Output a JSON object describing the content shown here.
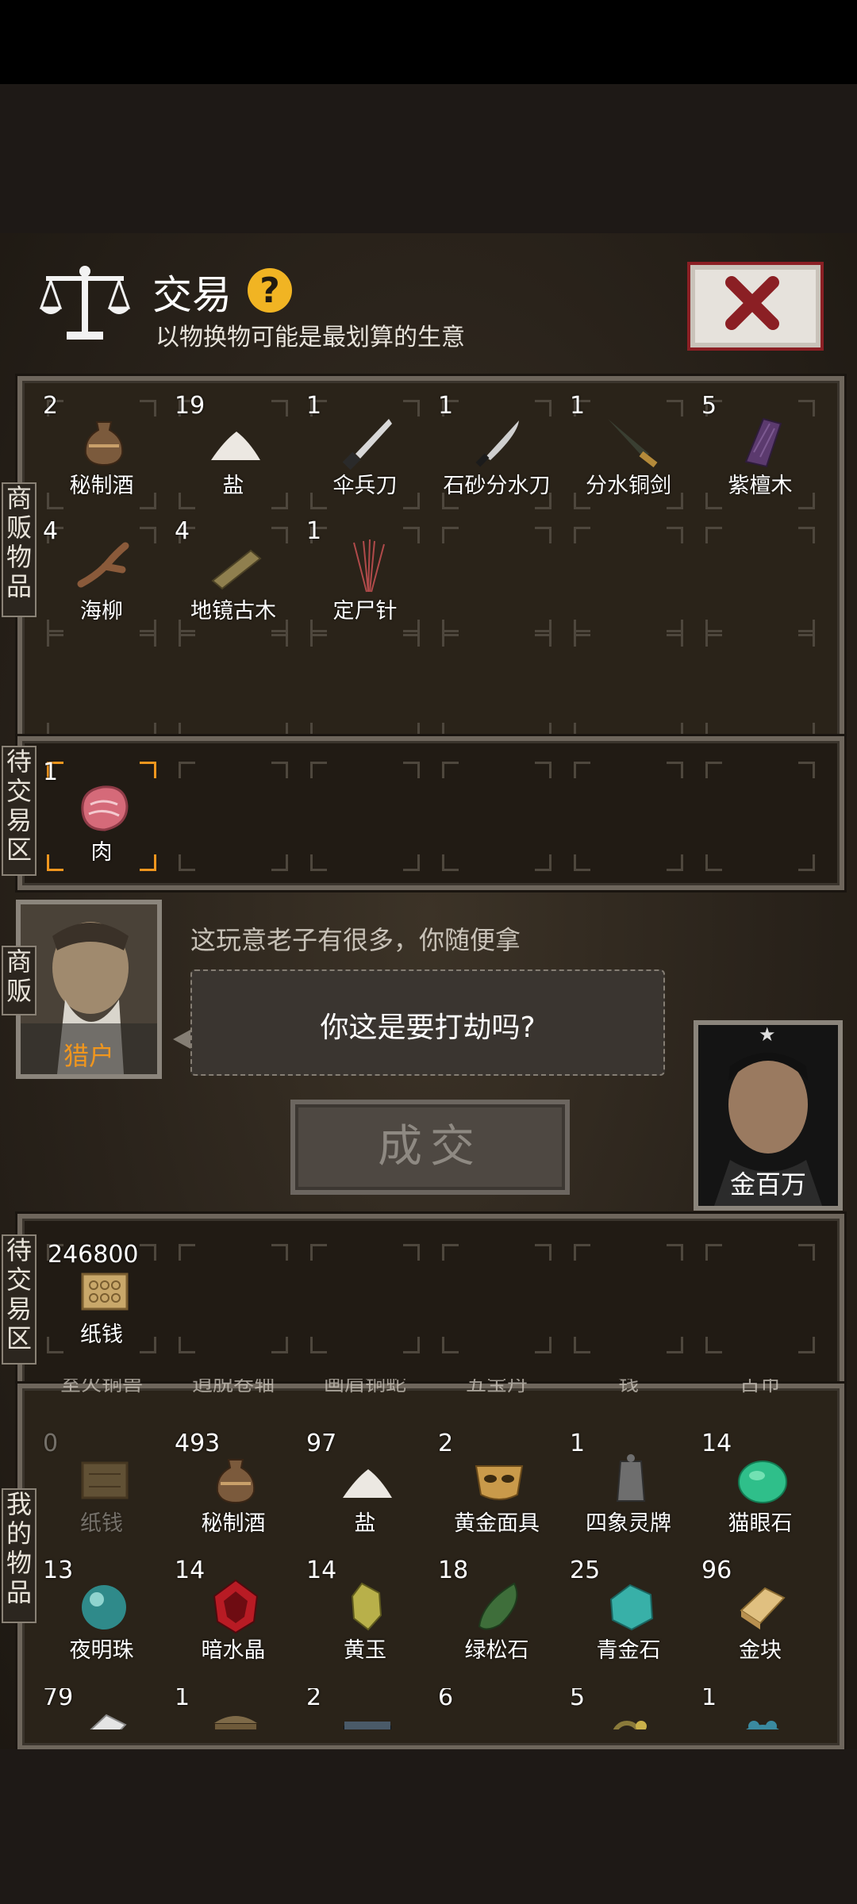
{
  "header": {
    "title": "交易",
    "help": "?",
    "subtitle": "以物换物可能是最划算的生意"
  },
  "tabs": {
    "vendor_items": "商贩物品",
    "pending_top": "待交易区",
    "vendor": "商贩",
    "pending_bottom": "待交易区",
    "my_items": "我的物品"
  },
  "vendor_items": [
    {
      "count": "2",
      "name": "秘制酒",
      "icon": "wine-jar-icon"
    },
    {
      "count": "19",
      "name": "盐",
      "icon": "salt-pile-icon"
    },
    {
      "count": "1",
      "name": "伞兵刀",
      "icon": "dagger-icon"
    },
    {
      "count": "1",
      "name": "石砂分水刀",
      "icon": "knife-icon"
    },
    {
      "count": "1",
      "name": "分水铜剑",
      "icon": "bronze-sword-icon"
    },
    {
      "count": "5",
      "name": "紫檀木",
      "icon": "rosewood-icon"
    },
    {
      "count": "4",
      "name": "海柳",
      "icon": "driftwood-icon"
    },
    {
      "count": "4",
      "name": "地镜古木",
      "icon": "old-wood-icon"
    },
    {
      "count": "1",
      "name": "定尸针",
      "icon": "needles-icon"
    }
  ],
  "pending_vendor": {
    "count": "1",
    "name": "肉",
    "icon": "meat-icon"
  },
  "vendor_npc": {
    "name": "猎户",
    "hint": "这玩意老子有很多，你随便拿",
    "speech": "你这是要打劫吗?"
  },
  "player": {
    "name": "金百万",
    "star": "★"
  },
  "deal_button": "成交",
  "pending_player": {
    "count": "246800",
    "name": "纸钱",
    "icon": "paper-money-icon"
  },
  "partial_labels": [
    "室火铜兽",
    "逍脱卷轴",
    "画眉铜蛇",
    "五宝丹",
    "钱",
    "古币"
  ],
  "my_items": [
    {
      "count": "0",
      "name": "纸钱",
      "icon": "paper-money-icon"
    },
    {
      "count": "493",
      "name": "秘制酒",
      "icon": "wine-jar-icon"
    },
    {
      "count": "97",
      "name": "盐",
      "icon": "salt-pile-icon"
    },
    {
      "count": "2",
      "name": "黄金面具",
      "icon": "golden-mask-icon"
    },
    {
      "count": "1",
      "name": "四象灵牌",
      "icon": "tablet-icon"
    },
    {
      "count": "14",
      "name": "猫眼石",
      "icon": "cats-eye-gem-icon"
    },
    {
      "count": "13",
      "name": "夜明珠",
      "icon": "night-pearl-icon"
    },
    {
      "count": "14",
      "name": "暗水晶",
      "icon": "dark-crystal-icon"
    },
    {
      "count": "14",
      "name": "黄玉",
      "icon": "topaz-icon"
    },
    {
      "count": "18",
      "name": "绿松石",
      "icon": "turquoise-icon"
    },
    {
      "count": "25",
      "name": "青金石",
      "icon": "lapis-icon"
    },
    {
      "count": "96",
      "name": "金块",
      "icon": "gold-bar-icon"
    },
    {
      "count": "79",
      "name": "",
      "icon": "silver-bar-icon"
    },
    {
      "count": "1",
      "name": "",
      "icon": "chest-icon"
    },
    {
      "count": "2",
      "name": "",
      "icon": "box-icon"
    },
    {
      "count": "6",
      "name": "",
      "icon": "bowl-icon"
    },
    {
      "count": "5",
      "name": "",
      "icon": "ring-icon"
    },
    {
      "count": "1",
      "name": "",
      "icon": "frog-icon"
    }
  ],
  "colors": {
    "accent": "#f0961e",
    "help": "#f1b423",
    "close": "#8b1f24",
    "vendor_name": "#f0961e"
  }
}
